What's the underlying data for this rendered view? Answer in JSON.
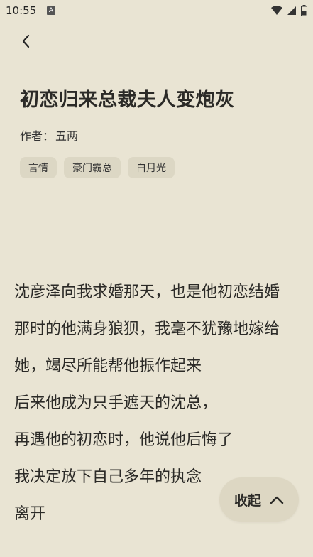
{
  "status_bar": {
    "time": "10:55",
    "a_icon": "A"
  },
  "book": {
    "title": "初恋归来总裁夫人变炮灰",
    "author_label": "作者：",
    "author": "五两",
    "tags": [
      "言情",
      "豪门霸总",
      "白月光"
    ]
  },
  "content": {
    "paragraphs": [
      "沈彦泽向我求婚那天，也是他初恋结婚",
      "那时的他满身狼狈，我毫不犹豫地嫁给她，竭尽所能帮他振作起来",
      "后来他成为只手遮天的沈总，",
      "再遇他的初恋时，他说他后悔了",
      "我决定放下自己多年的执念",
      "离开"
    ]
  },
  "actions": {
    "collapse_label": "收起"
  },
  "icons": {
    "back": "chevron-left-icon",
    "wifi": "wifi-icon",
    "signal": "signal-icon",
    "battery": "battery-icon",
    "collapse": "chevron-up-icon"
  }
}
